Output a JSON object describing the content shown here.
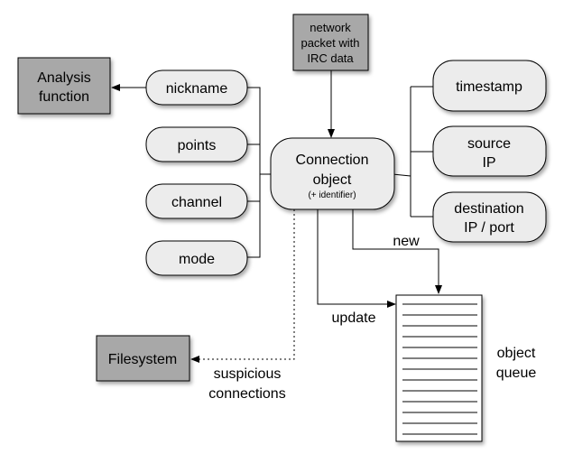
{
  "nodes": {
    "network_packet": [
      "network",
      "packet with",
      "IRC data"
    ],
    "analysis": [
      "Analysis",
      "function"
    ],
    "filesystem": "Filesystem",
    "connection": [
      "Connection",
      "object",
      "(+ identifier)"
    ],
    "nickname": "nickname",
    "points": "points",
    "channel": "channel",
    "mode": "mode",
    "timestamp": "timestamp",
    "source_ip": [
      "source",
      "IP"
    ],
    "destination": [
      "destination",
      "IP / port"
    ],
    "queue": [
      "object",
      "queue"
    ]
  },
  "edges": {
    "new": "new",
    "update": "update",
    "suspicious": [
      "suspicious",
      "connections"
    ]
  },
  "colors": {
    "gray_box": "#a8a8a8",
    "rounded_node": "#ececec"
  }
}
